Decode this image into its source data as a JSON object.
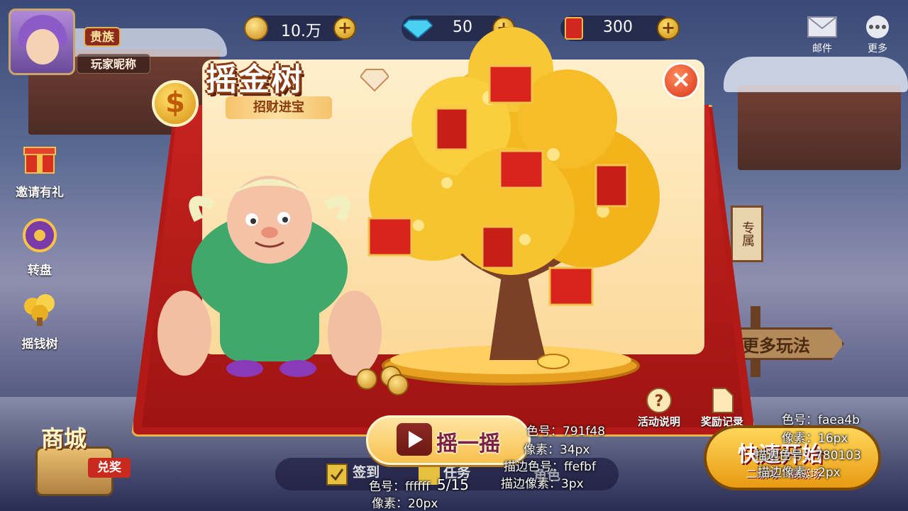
{
  "player": {
    "vip_label": "贵族",
    "nickname": "玩家昵称"
  },
  "currency": {
    "gold": "10.万",
    "diamond": "50",
    "redpacket": "300"
  },
  "top_buttons": {
    "mail": "邮件",
    "more": "更多"
  },
  "left_menu": {
    "invite": "邀请有礼",
    "wheel": "转盘",
    "money_tree": "摇钱树"
  },
  "popup": {
    "title": "摇金树",
    "subtitle": "招财进宝",
    "shake_button": "摇一摇",
    "activity_info": "活动说明",
    "reward_record": "奖励记录",
    "close": "×",
    "coin_symbol": "$"
  },
  "bottom_bar": {
    "signin": "签到",
    "task": "任务",
    "role": "角色",
    "progress": "5/15"
  },
  "shop": {
    "title": "商城",
    "exchange": "兑奖"
  },
  "quick_start": {
    "label": "快速开始",
    "sub": "二级场 - 高级场"
  },
  "side_sign": {
    "more_games": "更多玩法",
    "exclusive": "专属"
  },
  "annotations": {
    "a1_color": "色号：791f48",
    "a1_size": "像素：34px",
    "a1_stroke_color": "描边色号：ffefbf",
    "a1_stroke_size": "描边像素：3px",
    "a2_color": "色号：ffffff",
    "a2_size": "像素：20px",
    "a3_color": "色号：faea4b",
    "a3_size": "像素：16px",
    "a3_stroke_color": "描边色号：780103",
    "a3_stroke_size": "描边像素：2px"
  },
  "colors": {
    "shake_text": "#791f48",
    "shake_stroke": "#ffefbf",
    "quick_text": "#faea4b",
    "quick_stroke": "#780103"
  }
}
